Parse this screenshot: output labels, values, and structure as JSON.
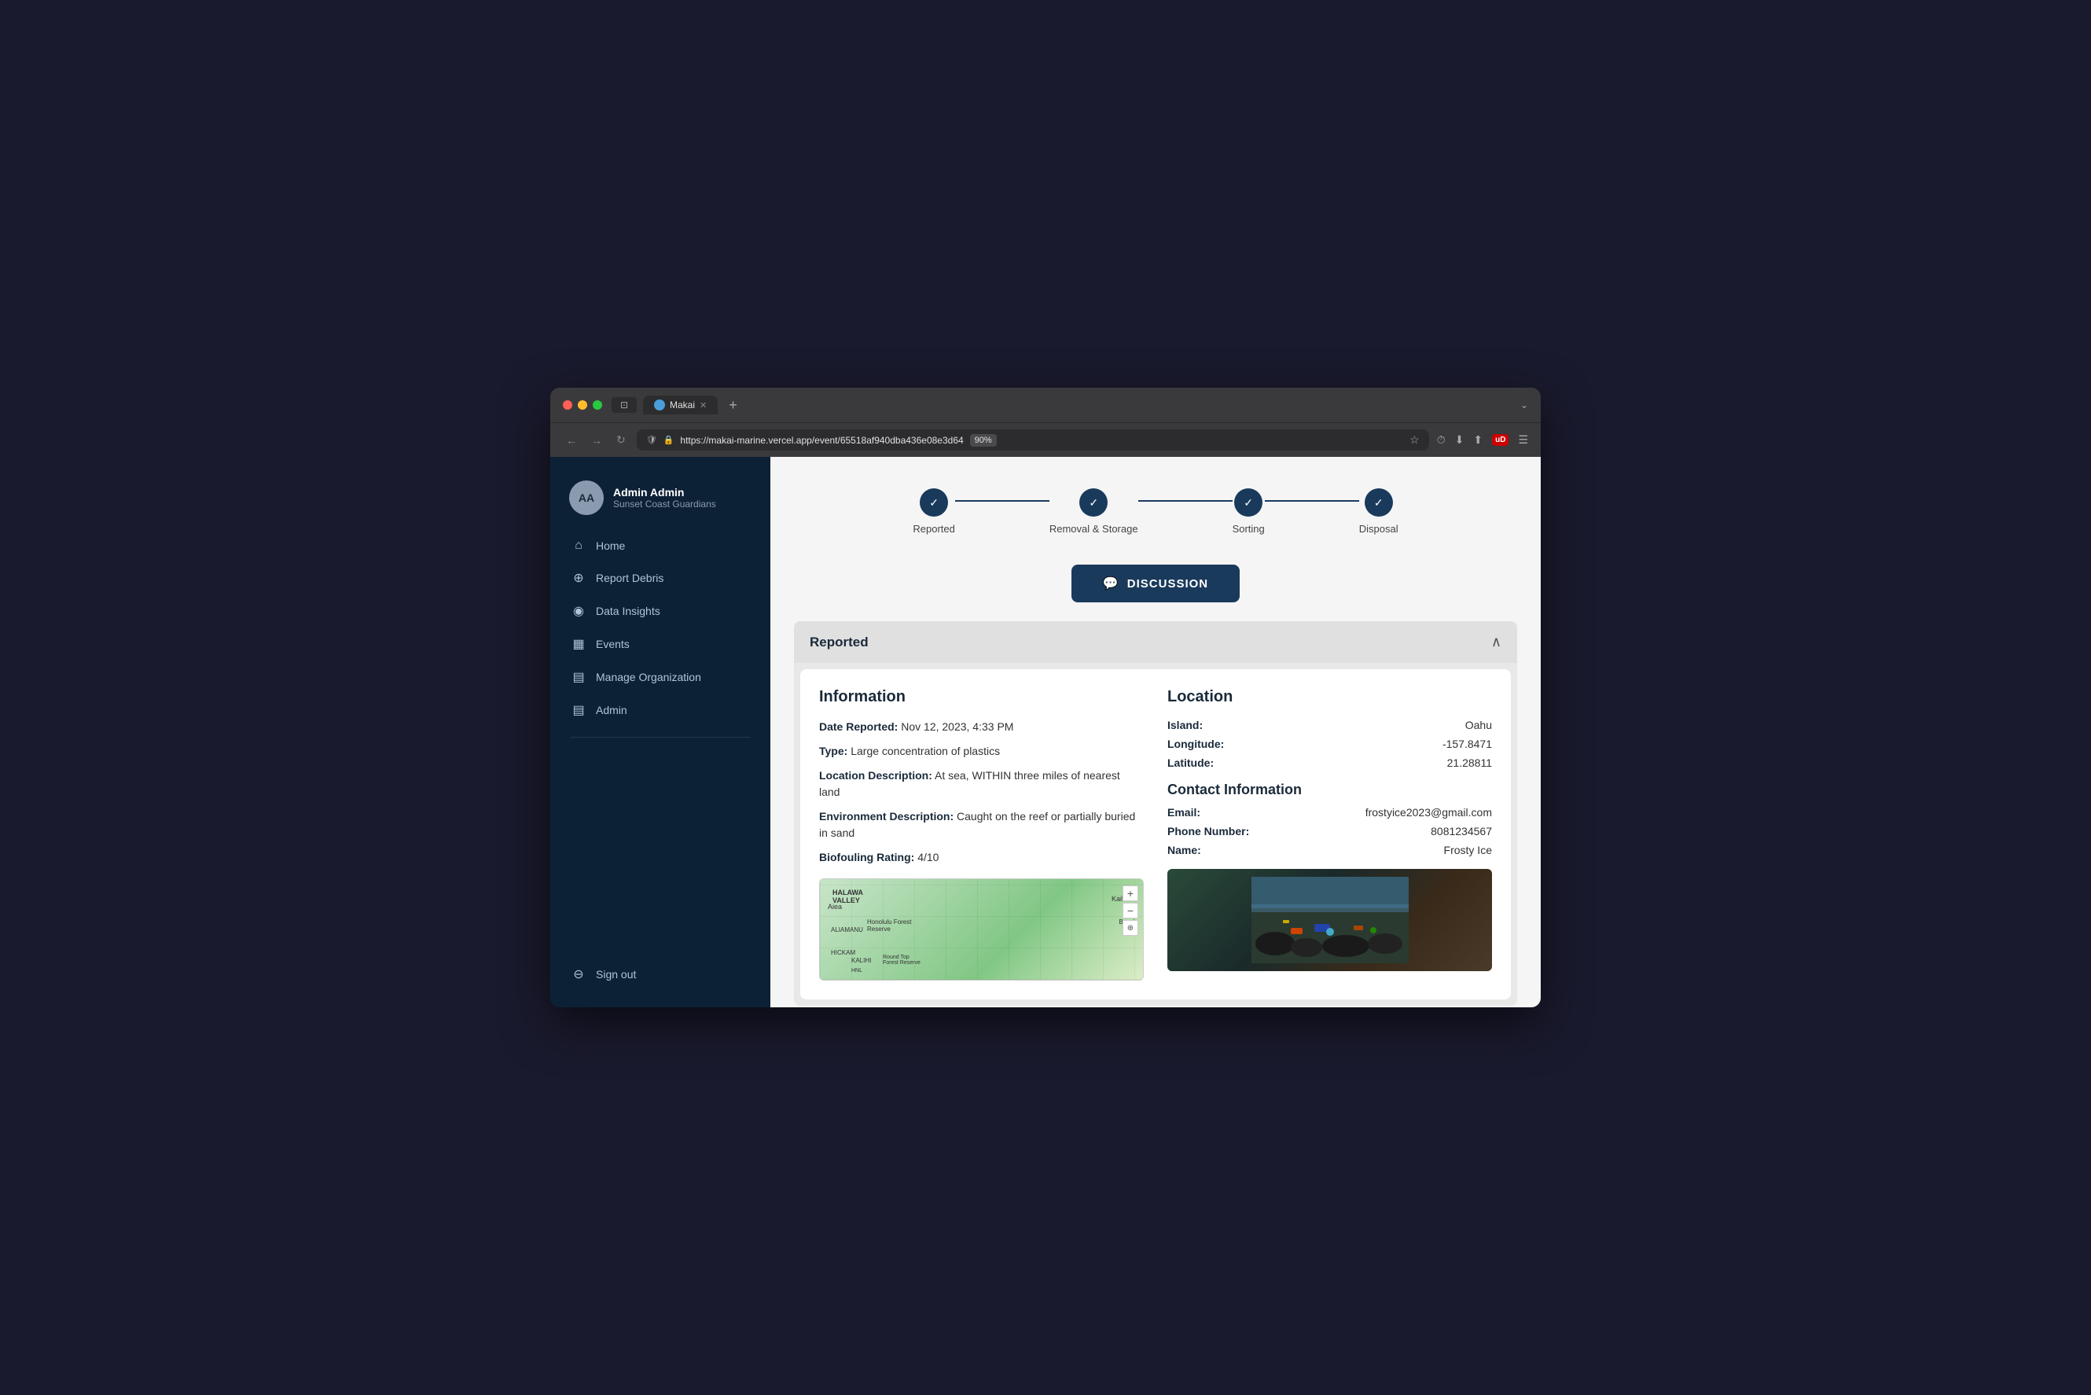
{
  "browser": {
    "tab_title": "Makai",
    "url": "https://makai-marine.vercel.app/event/65518af940dba436e08e3d64",
    "zoom": "90%"
  },
  "sidebar": {
    "user": {
      "initials": "AA",
      "name": "Admin Admin",
      "org": "Sunset Coast Guardians"
    },
    "nav_items": [
      {
        "id": "home",
        "label": "Home",
        "icon": "⌂"
      },
      {
        "id": "report",
        "label": "Report Debris",
        "icon": "⊕"
      },
      {
        "id": "insights",
        "label": "Data Insights",
        "icon": "◉"
      },
      {
        "id": "events",
        "label": "Events",
        "icon": "▦"
      },
      {
        "id": "manage",
        "label": "Manage Organization",
        "icon": "▤"
      },
      {
        "id": "admin",
        "label": "Admin",
        "icon": "▤"
      }
    ],
    "sign_out": "Sign out"
  },
  "progress": {
    "steps": [
      {
        "id": "reported",
        "label": "Reported",
        "completed": true
      },
      {
        "id": "removal",
        "label": "Removal & Storage",
        "completed": true
      },
      {
        "id": "sorting",
        "label": "Sorting",
        "completed": true
      },
      {
        "id": "disposal",
        "label": "Disposal",
        "completed": true
      }
    ]
  },
  "discussion_btn": "DISCUSSION",
  "reported_section": {
    "title": "Reported",
    "information": {
      "title": "Information",
      "date_label": "Date Reported:",
      "date_value": "Nov 12, 2023, 4:33 PM",
      "type_label": "Type:",
      "type_value": "Large concentration of plastics",
      "location_desc_label": "Location Description:",
      "location_desc_value": "At sea, WITHIN three miles of nearest land",
      "env_desc_label": "Environment Description:",
      "env_desc_value": "Caught on the reef or partially buried in sand",
      "biofouling_label": "Biofouling Rating:",
      "biofouling_value": "4/10"
    },
    "location": {
      "title": "Location",
      "island_label": "Island:",
      "island_value": "Oahu",
      "longitude_label": "Longitude:",
      "longitude_value": "-157.8471",
      "latitude_label": "Latitude:",
      "latitude_value": "21.28811"
    },
    "contact": {
      "title": "Contact Information",
      "email_label": "Email:",
      "email_value": "frostyice2023@gmail.com",
      "phone_label": "Phone Number:",
      "phone_value": "8081234567",
      "name_label": "Name:",
      "name_value": "Frosty Ice"
    }
  }
}
